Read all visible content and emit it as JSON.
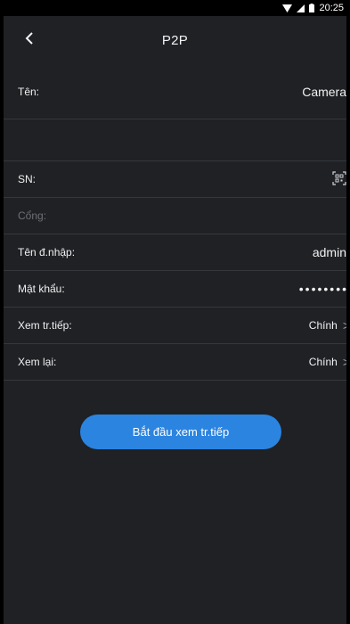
{
  "status": {
    "time": "20:25"
  },
  "navbar": {
    "title": "P2P"
  },
  "form": {
    "name_label": "Tên:",
    "name_value": "Camera",
    "sn_label": "SN:",
    "port_label": "Cổng:",
    "username_label": "Tên đ.nhập:",
    "username_value": "admin",
    "password_label": "Mật khẩu:",
    "password_value": "••••••••",
    "live_label": "Xem tr.tiếp:",
    "live_value": "Chính",
    "playback_label": "Xem lại:",
    "playback_value": "Chính",
    "chevron": ">"
  },
  "action": {
    "start_label": "Bắt đầu xem tr.tiếp"
  },
  "colors": {
    "background": "#1f2125",
    "accent": "#2b84e0",
    "divider": "#34373c"
  },
  "icons": [
    "back-icon",
    "qr-scan-icon",
    "wifi-icon",
    "signal-icon",
    "battery-icon",
    "chevron-right-icon"
  ]
}
